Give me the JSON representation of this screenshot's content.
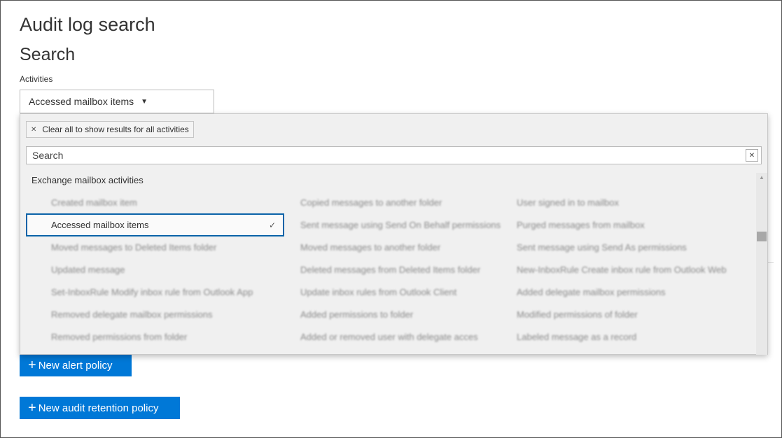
{
  "page": {
    "title": "Audit log search",
    "section_title": "Search",
    "activities_label": "Activities"
  },
  "dropdown": {
    "selected_label": "Accessed mailbox items",
    "clear_chip_label": "Clear all to show results for all activities",
    "search_placeholder": "Search",
    "group_heading": "Exchange mailbox activities",
    "columns": [
      [
        "Created mailbox item",
        "Accessed mailbox items",
        "Moved messages to Deleted Items folder",
        "Updated message",
        "Set-InboxRule Modify inbox rule from Outlook App",
        "Removed delegate mailbox permissions",
        "Removed permissions from folder"
      ],
      [
        "Copied messages to another folder",
        "Sent message using Send On Behalf permissions",
        "Moved messages to another folder",
        "Deleted messages from Deleted Items folder",
        "Update inbox rules from Outlook Client",
        "Added permissions to folder",
        "Added or removed user with delegate acces"
      ],
      [
        "User signed in to mailbox",
        "Purged messages from mailbox",
        "Sent message using Send As permissions",
        "New-InboxRule Create inbox rule from Outlook Web",
        "Added delegate mailbox permissions",
        "Modified permissions of folder",
        "Labeled message as a record"
      ]
    ],
    "selected_check": "✓"
  },
  "buttons": {
    "new_alert_policy": "New alert policy",
    "new_audit_retention_policy": "New audit retention policy",
    "plus": "+"
  },
  "colors": {
    "accent": "#0078d7",
    "selection_border": "#0a63a8"
  }
}
